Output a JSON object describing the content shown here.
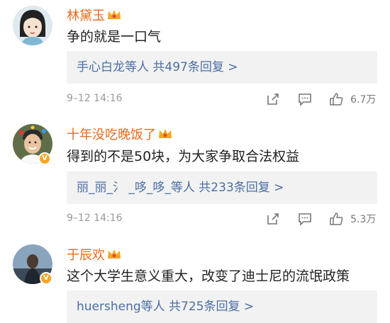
{
  "comments": [
    {
      "username": "林黛玉",
      "content": "争的就是一口气",
      "replies_text": "手心白龙等人 共497条回复 >",
      "time": "9–12 14:16",
      "likes": "6.7万",
      "avatar_icon": "cartoon-girl-avatar",
      "has_v_badge": false
    },
    {
      "username": "十年没吃晚饭了",
      "content": "得到的不是50块，为大家争取合法权益",
      "replies_text": "丽_丽_氵 _哆_哆_等人 共233条回复 >",
      "time": "9–12 14:16",
      "likes": "5.3万",
      "avatar_icon": "photo-avatar",
      "has_v_badge": true
    },
    {
      "username": "于辰欢",
      "content": "这个大学生意义重大，改变了迪士尼的流氓政策",
      "replies_text": "huersheng等人 共725条回复 >",
      "avatar_icon": "photo-avatar",
      "has_v_badge": true
    }
  ],
  "colors": {
    "username": "#e86a1e",
    "reply_link": "#4a6fa5",
    "reply_bg": "#f2f2f2",
    "meta_gray": "#999999",
    "vip_gold": "#f5a623"
  }
}
